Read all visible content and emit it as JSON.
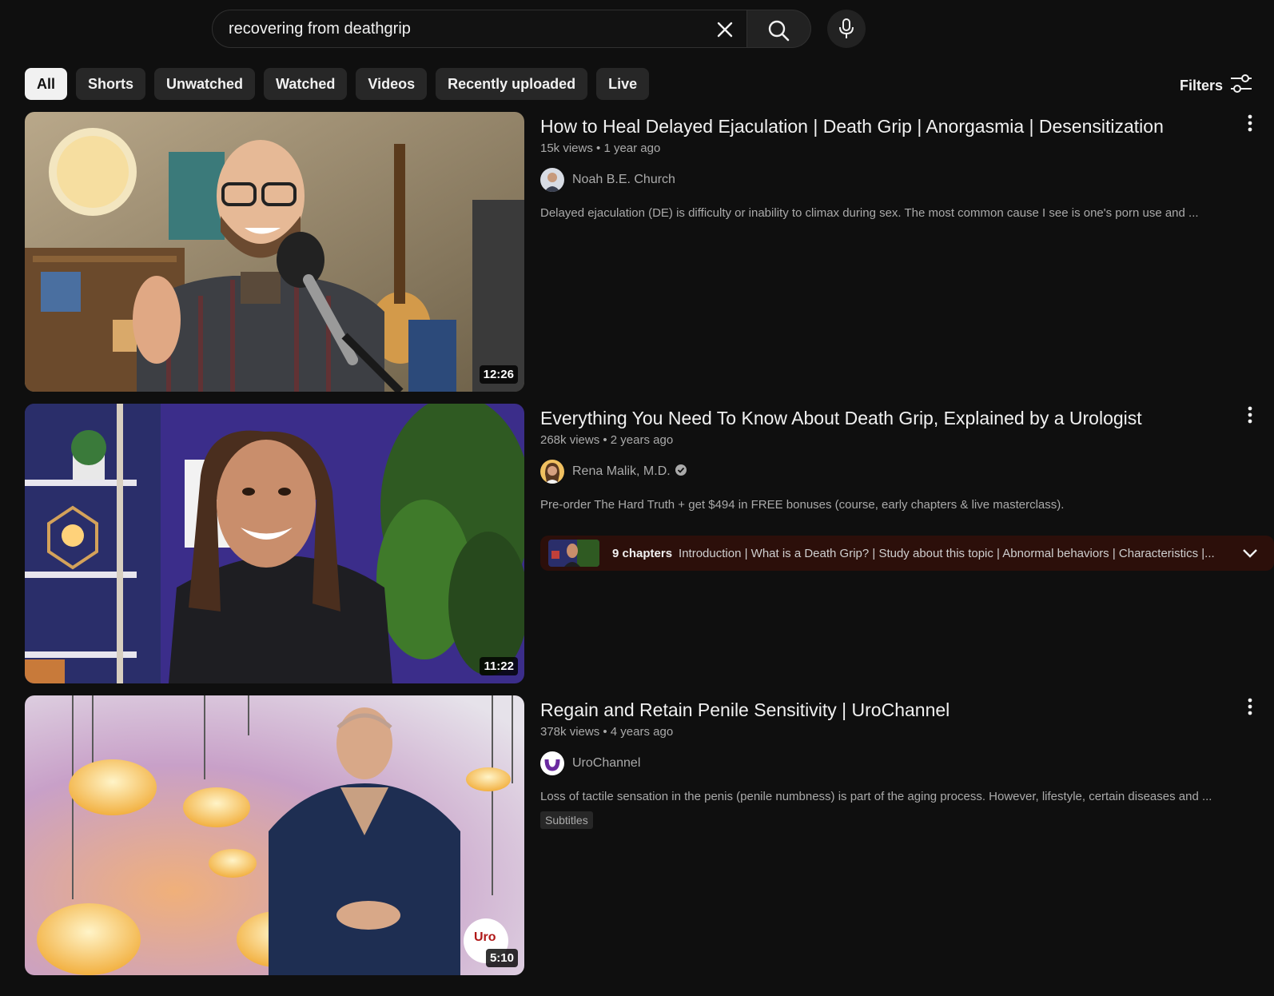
{
  "search": {
    "query": "recovering from deathgrip",
    "clear_icon": "close-icon",
    "search_icon": "search-icon",
    "mic_icon": "microphone-icon"
  },
  "chips": [
    "All",
    "Shorts",
    "Unwatched",
    "Watched",
    "Videos",
    "Recently uploaded",
    "Live"
  ],
  "filters": {
    "label": "Filters",
    "icon": "sliders-icon"
  },
  "results": [
    {
      "title": "How to Heal Delayed Ejaculation | Death Grip | Anorgasmia | Desensitization",
      "views": "15k views",
      "age": "1 year ago",
      "channel": "Noah B.E. Church",
      "description": "Delayed ejaculation (DE) is difficulty or inability to climax during sex. The most common cause I see is one's porn use and ...",
      "duration": "12:26"
    },
    {
      "title": "Everything You Need To Know About Death Grip, Explained by a Urologist",
      "views": "268k views",
      "age": "2 years ago",
      "channel": "Rena Malik, M.D.",
      "verified": true,
      "description": "Pre-order The Hard Truth + get $494 in FREE bonuses (course, early chapters & live masterclass).",
      "duration": "11:22",
      "chapters": {
        "count": "9 chapters",
        "list": "Introduction | What is a Death Grip? | Study about this topic | Abnormal behaviors | Characteristics |..."
      }
    },
    {
      "title": "Regain and Retain Penile Sensitivity | UroChannel",
      "views": "378k views",
      "age": "4 years ago",
      "channel": "UroChannel",
      "description": "Loss of tactile sensation in the penis (penile numbness) is part of the aging process. However, lifestyle, certain diseases and ...",
      "badge": "Subtitles",
      "duration": "5:10",
      "watermark": "Uro"
    }
  ],
  "colors": {
    "background": "#0f0f0f",
    "chip": "#272727",
    "chip_active": "#f1f1f1",
    "chapters_bg": "#2c0f0a"
  }
}
